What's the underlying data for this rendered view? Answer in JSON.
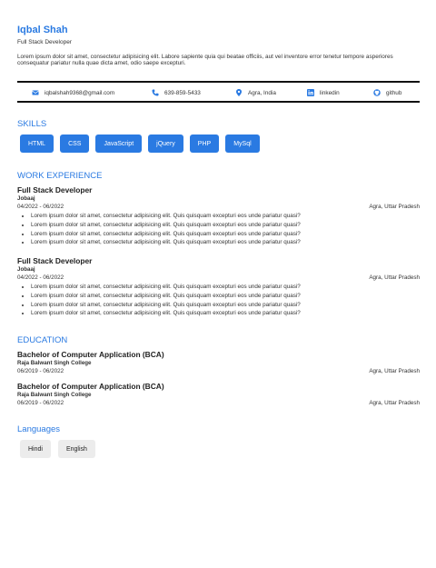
{
  "header": {
    "name": "Iqbal Shah",
    "role": "Full Stack Developer",
    "summary": "Lorem ipsum dolor sit amet, consectetur adipisicing elit. Labore sapiente quia qui beatae officiis, aut vel inventore error tenetur tempore asperiores consequatur pariatur nulla quae dicta amet, odio saepe excepturi."
  },
  "contact": {
    "email": "iqbalshah9368@gmail.com",
    "phone": "639-859-5433",
    "location": "Agra, India",
    "linkedin": "linkedin",
    "github": "github",
    "icon_names": [
      "email-icon",
      "phone-icon",
      "location-pin-icon",
      "linkedin-icon",
      "github-icon"
    ],
    "icon_color": "#2a7ae2"
  },
  "sections": {
    "skills": "SKILLS",
    "work": "WORK EXPERIENCE",
    "education": "EDUCATION",
    "languages": "Languages"
  },
  "skills": [
    "HTML",
    "CSS",
    "JavaScript",
    "jQuery",
    "PHP",
    "MySql"
  ],
  "work": [
    {
      "title": "Full Stack Developer",
      "company": "Jobaaj",
      "dates": "04/2022 - 06/2022",
      "location": "Agra, Uttar Pradesh",
      "bullets": [
        "Lorem ipsum dolor sit amet, consectetur adipisicing elit. Quis quisquam excepturi eos unde pariatur quasi?",
        "Lorem ipsum dolor sit amet, consectetur adipisicing elit. Quis quisquam excepturi eos unde pariatur quasi?",
        "Lorem ipsum dolor sit amet, consectetur adipisicing elit. Quis quisquam excepturi eos unde pariatur quasi?",
        "Lorem ipsum dolor sit amet, consectetur adipisicing elit. Quis quisquam excepturi eos unde pariatur quasi?"
      ]
    },
    {
      "title": "Full Stack Developer",
      "company": "Jobaaj",
      "dates": "04/2022 - 06/2022",
      "location": "Agra, Uttar Pradesh",
      "bullets": [
        "Lorem ipsum dolor sit amet, consectetur adipisicing elit. Quis quisquam excepturi eos unde pariatur quasi?",
        "Lorem ipsum dolor sit amet, consectetur adipisicing elit. Quis quisquam excepturi eos unde pariatur quasi?",
        "Lorem ipsum dolor sit amet, consectetur adipisicing elit. Quis quisquam excepturi eos unde pariatur quasi?",
        "Lorem ipsum dolor sit amet, consectetur adipisicing elit. Quis quisquam excepturi eos unde pariatur quasi?"
      ]
    }
  ],
  "education": [
    {
      "degree": "Bachelor of Computer Application (BCA)",
      "school": "Raja Balwant Singh College",
      "dates": "06/2019 - 06/2022",
      "location": "Agra, Uttar Pradesh"
    },
    {
      "degree": "Bachelor of Computer Application (BCA)",
      "school": "Raja Balwant Singh College",
      "dates": "06/2019 - 06/2022",
      "location": "Agra, Uttar Pradesh"
    }
  ],
  "languages": [
    "Hindi",
    "English"
  ],
  "colors": {
    "accent": "#2a7ae2",
    "chip_bg": "#ececec",
    "text": "#222222"
  }
}
